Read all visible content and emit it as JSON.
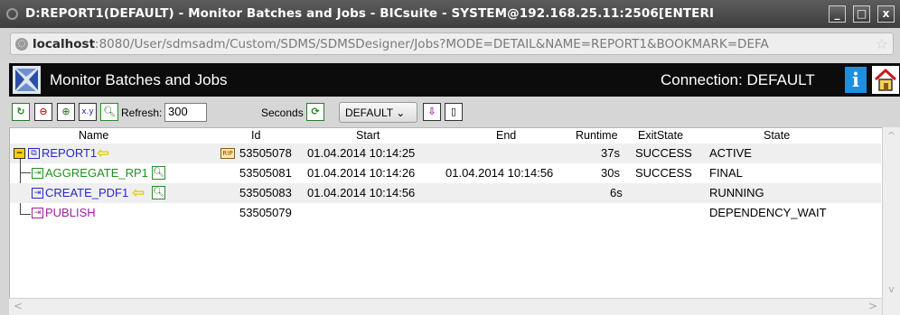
{
  "window": {
    "title": "D:REPORT1(DEFAULT) - Monitor Batches and Jobs - BICsuite - SYSTEM@192.168.25.11:2506[ENTERI",
    "buttons": [
      "_",
      "□",
      "x"
    ]
  },
  "browser": {
    "url_host": "localhost",
    "url_rest": ":8080/User/sdmsadm/Custom/SDMS/SDMSDesigner/Jobs?MODE=DETAIL&NAME=REPORT1&BOOKMARK=DEFA"
  },
  "app": {
    "title": "Monitor Batches and Jobs",
    "connection": "Connection: DEFAULT"
  },
  "toolbar": {
    "refresh_label": "Refresh:",
    "refresh_value": "300",
    "seconds_label": "Seconds",
    "bookmark_value": "DEFAULT",
    "xy_label": "x.y"
  },
  "table": {
    "headers": {
      "name": "Name",
      "id": "Id",
      "start": "Start",
      "end": "End",
      "runtime": "Runtime",
      "exitstate": "ExitState",
      "state": "State"
    },
    "rows": [
      {
        "name": "REPORT1",
        "id": "53505078",
        "start": "01.04.2014 10:14:25",
        "end": "",
        "runtime": "37s",
        "exitstate": "SUCCESS",
        "state": "ACTIVE",
        "color": "#2828c8"
      },
      {
        "name": "AGGREGATE_RP1",
        "id": "53505081",
        "start": "01.04.2014 10:14:26",
        "end": "01.04.2014 10:14:56",
        "runtime": "30s",
        "exitstate": "SUCCESS",
        "state": "FINAL",
        "color": "#1f8f1f"
      },
      {
        "name": "CREATE_PDF1",
        "id": "53505083",
        "start": "01.04.2014 10:14:56",
        "end": "",
        "runtime": "6s",
        "exitstate": "",
        "state": "RUNNING",
        "color": "#2828c8"
      },
      {
        "name": "PUBLISH",
        "id": "53505079",
        "start": "",
        "end": "",
        "runtime": "",
        "exitstate": "",
        "state": "DEPENDENCY_WAIT",
        "color": "#a020a0"
      }
    ],
    "rip_badge": "RIP"
  }
}
